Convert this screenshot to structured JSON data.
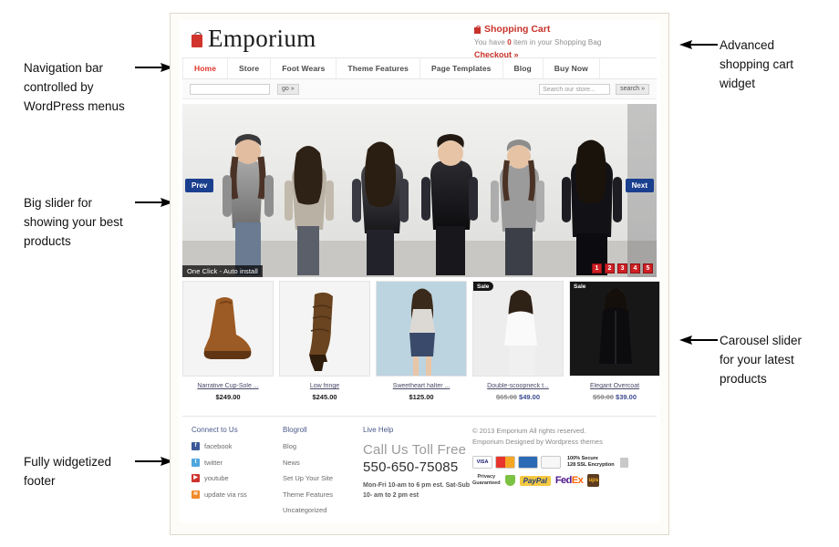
{
  "annotations": [
    {
      "id": "nav",
      "text": "Navigation bar\ncontrolled by\nWordPress menus",
      "dir": "right"
    },
    {
      "id": "slider",
      "text": "Big slider for\nshowing your best\nproducts",
      "dir": "right"
    },
    {
      "id": "footer",
      "text": "Fully widgetized\nfooter",
      "dir": "right"
    },
    {
      "id": "cart",
      "text": "Advanced\nshopping cart\nwidget",
      "dir": "left"
    },
    {
      "id": "carousel",
      "text": "Carousel slider\nfor your latest\nproducts",
      "dir": "left"
    }
  ],
  "site": {
    "brand": "Emporium",
    "brand_icon": "shopping-bag-icon",
    "cart": {
      "icon": "shopping-bag-icon",
      "title": "Shopping Cart",
      "message_before": "You have ",
      "count": "0",
      "message_after": " item in your Shopping Bag",
      "checkout": "Checkout »"
    },
    "nav": [
      {
        "label": "Home",
        "active": true
      },
      {
        "label": "Store",
        "active": false
      },
      {
        "label": "Foot Wears",
        "active": false
      },
      {
        "label": "Theme Features",
        "active": false
      },
      {
        "label": "Page Templates",
        "active": false
      },
      {
        "label": "Blog",
        "active": false
      },
      {
        "label": "Buy Now",
        "active": false
      }
    ],
    "searchbar": {
      "left_value": "",
      "left_placeholder": "",
      "go_label": "go »",
      "right_value": "",
      "right_placeholder": "Search our store...",
      "search_label": "search »"
    },
    "slider": {
      "caption": "One Click - Auto install",
      "prev_label": "Prev",
      "next_label": "Next",
      "pages": [
        "1",
        "2",
        "3",
        "4",
        "5"
      ]
    },
    "products": [
      {
        "name": "Narrative Cup-Sole ...",
        "price": "$249.00",
        "sale": false,
        "old_price": "",
        "new_price": ""
      },
      {
        "name": "Low fringe",
        "price": "$245.00",
        "sale": false,
        "old_price": "",
        "new_price": ""
      },
      {
        "name": "Sweetheart halter ...",
        "price": "$125.00",
        "sale": false,
        "old_price": "",
        "new_price": ""
      },
      {
        "name": "Double-scoopneck t...",
        "price": "",
        "sale": true,
        "old_price": "$65.00",
        "new_price": "$49.00",
        "sale_label": "Sale"
      },
      {
        "name": "Elegant Overcoat",
        "price": "",
        "sale": true,
        "old_price": "$50.00",
        "new_price": "$39.00",
        "sale_label": "Sale"
      }
    ],
    "footer": {
      "connect": {
        "heading": "Connect to Us",
        "items": [
          {
            "label": "facebook",
            "icon": "facebook-icon"
          },
          {
            "label": "twitter",
            "icon": "twitter-icon"
          },
          {
            "label": "youtube",
            "icon": "youtube-icon"
          },
          {
            "label": "update via rss",
            "icon": "rss-icon"
          }
        ]
      },
      "blogroll": {
        "heading": "Blogroll",
        "items": [
          "Blog",
          "News",
          "Set Up Your Site",
          "Theme Features",
          "Uncategorized"
        ]
      },
      "livehelp": {
        "heading": "Live Help",
        "tagline": "Call Us Toll Free",
        "phone": "550-650-75085",
        "hours": "Mon-Fri 10-am to 6 pm est. Sat-Sub 10- am to 2 pm est"
      },
      "legal": {
        "line1": "© 2013 Emporium All rights reserved.",
        "line2": "Emporium Designed by Wordpress themes",
        "cards": [
          "VISA",
          "MC",
          "AMEX",
          "DISC"
        ],
        "ssl_line1": "100% Secure",
        "ssl_line2": "128 SSL Encryption",
        "privacy_line1": "Privacy",
        "privacy_line2": "Guaranteed",
        "paypal": "PayPal",
        "fedex_1": "Fed",
        "fedex_2": "Ex",
        "ups": "ups"
      }
    }
  }
}
